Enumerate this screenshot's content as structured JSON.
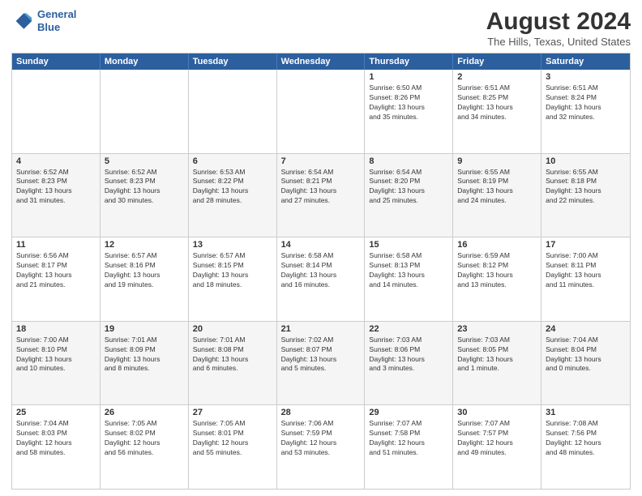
{
  "header": {
    "logo_line1": "General",
    "logo_line2": "Blue",
    "title": "August 2024",
    "subtitle": "The Hills, Texas, United States"
  },
  "days_of_week": [
    "Sunday",
    "Monday",
    "Tuesday",
    "Wednesday",
    "Thursday",
    "Friday",
    "Saturday"
  ],
  "weeks": [
    {
      "alt": false,
      "cells": [
        {
          "day": "",
          "info": ""
        },
        {
          "day": "",
          "info": ""
        },
        {
          "day": "",
          "info": ""
        },
        {
          "day": "",
          "info": ""
        },
        {
          "day": "1",
          "info": "Sunrise: 6:50 AM\nSunset: 8:26 PM\nDaylight: 13 hours\nand 35 minutes."
        },
        {
          "day": "2",
          "info": "Sunrise: 6:51 AM\nSunset: 8:25 PM\nDaylight: 13 hours\nand 34 minutes."
        },
        {
          "day": "3",
          "info": "Sunrise: 6:51 AM\nSunset: 8:24 PM\nDaylight: 13 hours\nand 32 minutes."
        }
      ]
    },
    {
      "alt": true,
      "cells": [
        {
          "day": "4",
          "info": "Sunrise: 6:52 AM\nSunset: 8:23 PM\nDaylight: 13 hours\nand 31 minutes."
        },
        {
          "day": "5",
          "info": "Sunrise: 6:52 AM\nSunset: 8:23 PM\nDaylight: 13 hours\nand 30 minutes."
        },
        {
          "day": "6",
          "info": "Sunrise: 6:53 AM\nSunset: 8:22 PM\nDaylight: 13 hours\nand 28 minutes."
        },
        {
          "day": "7",
          "info": "Sunrise: 6:54 AM\nSunset: 8:21 PM\nDaylight: 13 hours\nand 27 minutes."
        },
        {
          "day": "8",
          "info": "Sunrise: 6:54 AM\nSunset: 8:20 PM\nDaylight: 13 hours\nand 25 minutes."
        },
        {
          "day": "9",
          "info": "Sunrise: 6:55 AM\nSunset: 8:19 PM\nDaylight: 13 hours\nand 24 minutes."
        },
        {
          "day": "10",
          "info": "Sunrise: 6:55 AM\nSunset: 8:18 PM\nDaylight: 13 hours\nand 22 minutes."
        }
      ]
    },
    {
      "alt": false,
      "cells": [
        {
          "day": "11",
          "info": "Sunrise: 6:56 AM\nSunset: 8:17 PM\nDaylight: 13 hours\nand 21 minutes."
        },
        {
          "day": "12",
          "info": "Sunrise: 6:57 AM\nSunset: 8:16 PM\nDaylight: 13 hours\nand 19 minutes."
        },
        {
          "day": "13",
          "info": "Sunrise: 6:57 AM\nSunset: 8:15 PM\nDaylight: 13 hours\nand 18 minutes."
        },
        {
          "day": "14",
          "info": "Sunrise: 6:58 AM\nSunset: 8:14 PM\nDaylight: 13 hours\nand 16 minutes."
        },
        {
          "day": "15",
          "info": "Sunrise: 6:58 AM\nSunset: 8:13 PM\nDaylight: 13 hours\nand 14 minutes."
        },
        {
          "day": "16",
          "info": "Sunrise: 6:59 AM\nSunset: 8:12 PM\nDaylight: 13 hours\nand 13 minutes."
        },
        {
          "day": "17",
          "info": "Sunrise: 7:00 AM\nSunset: 8:11 PM\nDaylight: 13 hours\nand 11 minutes."
        }
      ]
    },
    {
      "alt": true,
      "cells": [
        {
          "day": "18",
          "info": "Sunrise: 7:00 AM\nSunset: 8:10 PM\nDaylight: 13 hours\nand 10 minutes."
        },
        {
          "day": "19",
          "info": "Sunrise: 7:01 AM\nSunset: 8:09 PM\nDaylight: 13 hours\nand 8 minutes."
        },
        {
          "day": "20",
          "info": "Sunrise: 7:01 AM\nSunset: 8:08 PM\nDaylight: 13 hours\nand 6 minutes."
        },
        {
          "day": "21",
          "info": "Sunrise: 7:02 AM\nSunset: 8:07 PM\nDaylight: 13 hours\nand 5 minutes."
        },
        {
          "day": "22",
          "info": "Sunrise: 7:03 AM\nSunset: 8:06 PM\nDaylight: 13 hours\nand 3 minutes."
        },
        {
          "day": "23",
          "info": "Sunrise: 7:03 AM\nSunset: 8:05 PM\nDaylight: 13 hours\nand 1 minute."
        },
        {
          "day": "24",
          "info": "Sunrise: 7:04 AM\nSunset: 8:04 PM\nDaylight: 13 hours\nand 0 minutes."
        }
      ]
    },
    {
      "alt": false,
      "cells": [
        {
          "day": "25",
          "info": "Sunrise: 7:04 AM\nSunset: 8:03 PM\nDaylight: 12 hours\nand 58 minutes."
        },
        {
          "day": "26",
          "info": "Sunrise: 7:05 AM\nSunset: 8:02 PM\nDaylight: 12 hours\nand 56 minutes."
        },
        {
          "day": "27",
          "info": "Sunrise: 7:05 AM\nSunset: 8:01 PM\nDaylight: 12 hours\nand 55 minutes."
        },
        {
          "day": "28",
          "info": "Sunrise: 7:06 AM\nSunset: 7:59 PM\nDaylight: 12 hours\nand 53 minutes."
        },
        {
          "day": "29",
          "info": "Sunrise: 7:07 AM\nSunset: 7:58 PM\nDaylight: 12 hours\nand 51 minutes."
        },
        {
          "day": "30",
          "info": "Sunrise: 7:07 AM\nSunset: 7:57 PM\nDaylight: 12 hours\nand 49 minutes."
        },
        {
          "day": "31",
          "info": "Sunrise: 7:08 AM\nSunset: 7:56 PM\nDaylight: 12 hours\nand 48 minutes."
        }
      ]
    }
  ]
}
